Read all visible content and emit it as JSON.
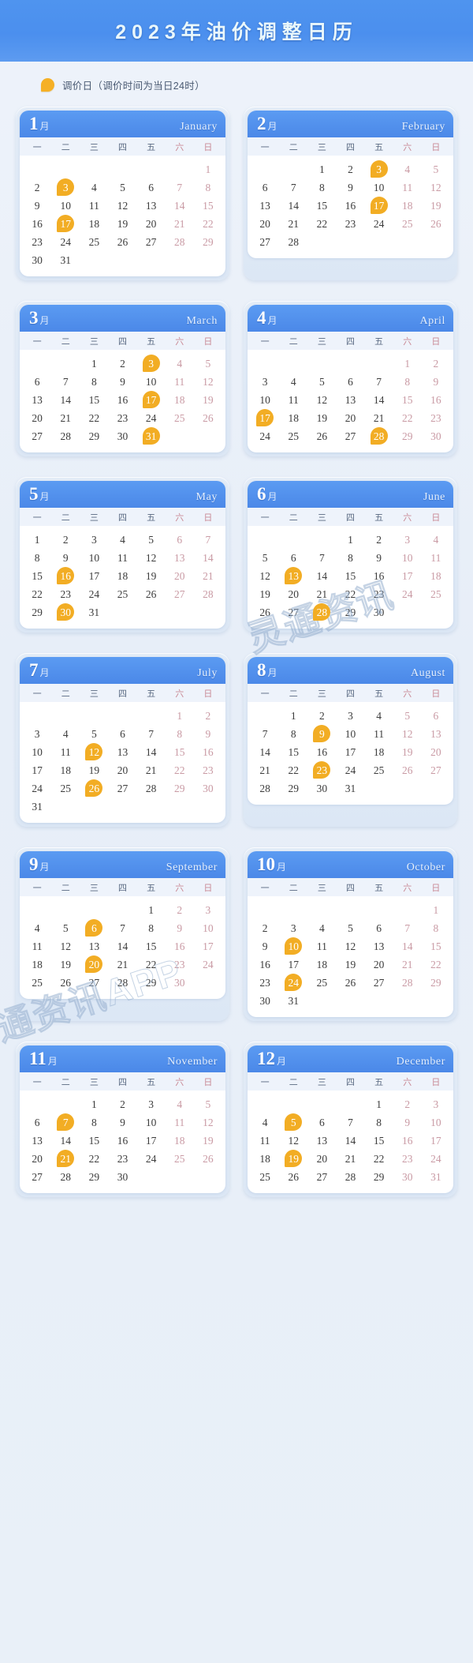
{
  "header": {
    "title": "2023年油价调整日历"
  },
  "legend": {
    "icon": "oil-drop-icon",
    "text": "调价日（调价时间为当日24时）"
  },
  "weekday_labels": [
    "一",
    "二",
    "三",
    "四",
    "五",
    "六",
    "日"
  ],
  "watermarks": [
    "灵通资讯",
    "通资讯APP"
  ],
  "colors": {
    "banner": "#4b8fee",
    "card_head": "#5b9bf2",
    "highlight": "#f2ad24",
    "weekend_text": "#c99aa4",
    "page_bg": "#e9f0f8"
  },
  "months": [
    {
      "num": "1",
      "cn": "月",
      "en": "January",
      "start": 6,
      "days": 31,
      "highlights": [
        3,
        17
      ]
    },
    {
      "num": "2",
      "cn": "月",
      "en": "February",
      "start": 2,
      "days": 28,
      "highlights": [
        3,
        17
      ]
    },
    {
      "num": "3",
      "cn": "月",
      "en": "March",
      "start": 2,
      "days": 31,
      "highlights": [
        3,
        17,
        31
      ]
    },
    {
      "num": "4",
      "cn": "月",
      "en": "April",
      "start": 5,
      "days": 30,
      "highlights": [
        17,
        28
      ]
    },
    {
      "num": "5",
      "cn": "月",
      "en": "May",
      "start": 0,
      "days": 31,
      "highlights": [
        16,
        30
      ]
    },
    {
      "num": "6",
      "cn": "月",
      "en": "June",
      "start": 3,
      "days": 30,
      "highlights": [
        13,
        28
      ]
    },
    {
      "num": "7",
      "cn": "月",
      "en": "July",
      "start": 5,
      "days": 31,
      "highlights": [
        12,
        26
      ]
    },
    {
      "num": "8",
      "cn": "月",
      "en": "August",
      "start": 1,
      "days": 31,
      "highlights": [
        9,
        23
      ]
    },
    {
      "num": "9",
      "cn": "月",
      "en": "September",
      "start": 4,
      "days": 30,
      "highlights": [
        6,
        20
      ]
    },
    {
      "num": "10",
      "cn": "月",
      "en": "October",
      "start": 6,
      "days": 31,
      "highlights": [
        10,
        24
      ]
    },
    {
      "num": "11",
      "cn": "月",
      "en": "November",
      "start": 2,
      "days": 30,
      "highlights": [
        7,
        21
      ]
    },
    {
      "num": "12",
      "cn": "月",
      "en": "December",
      "start": 4,
      "days": 31,
      "highlights": [
        5,
        19
      ]
    }
  ]
}
